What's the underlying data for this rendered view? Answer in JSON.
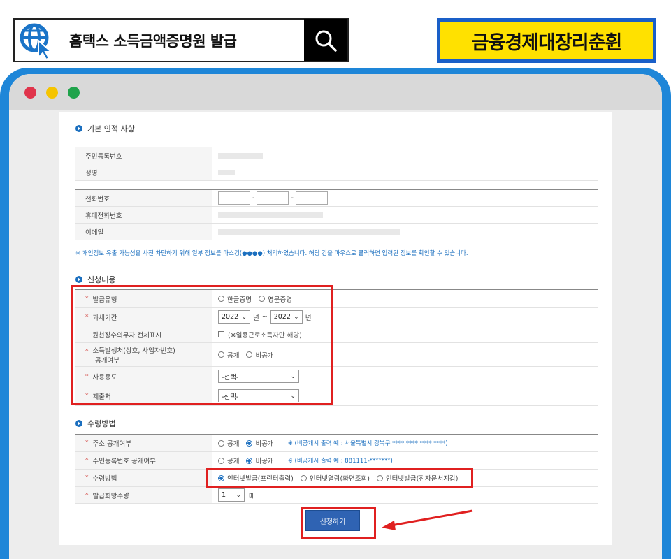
{
  "search": {
    "query": "홈택스 소득금액증명원 발급"
  },
  "brand": {
    "label": "금융경제대장리춘휜"
  },
  "window_dots": [
    "#e0344b",
    "#f5c400",
    "#1fa34b"
  ],
  "basic": {
    "title": "기본 인적 사항",
    "rows": [
      "주민등록번호",
      "성명"
    ],
    "contact_rows": [
      "전화번호",
      "휴대전화번호",
      "이메일"
    ],
    "notice": "※ 개인정보 유출 가능성을 사전 차단하기 위해 일부 정보를 마스킹(●●●●) 처리하였습니다. 해당 칸을 마우스로 클릭하면 입력된 정보를 확인할 수 있습니다."
  },
  "apply": {
    "title": "신청내용",
    "issue_type": {
      "label": "발급유형",
      "options": [
        "한글증명",
        "영문증명"
      ]
    },
    "tax_period": {
      "label": "과세기간",
      "from": "2022",
      "from_unit": "년",
      "sep": "~",
      "to": "2022",
      "to_unit": "년"
    },
    "withholding": {
      "label": "원천징수의무자 전체표시",
      "text": "(※일용근로소득자만 해당)"
    },
    "income_source": {
      "label_line1": "소득발생처(상호, 사업자번호)",
      "label_line2": "공개여부",
      "options": [
        "공개",
        "비공개"
      ]
    },
    "purpose": {
      "label": "사용용도",
      "value": "-선택-"
    },
    "submit_to": {
      "label": "제출처",
      "value": "-선택-"
    }
  },
  "receive": {
    "title": "수령방법",
    "address": {
      "label": "주소 공개여부",
      "options": [
        "공개",
        "비공개"
      ],
      "hint": "※ (비공개시 출력 예 : 서울특별시 강북구 **** **** **** ****)"
    },
    "rrn": {
      "label": "주민등록번호 공개여부",
      "options": [
        "공개",
        "비공개"
      ],
      "hint": "※ (비공개시 출력 예 : 881111-*******)"
    },
    "method": {
      "label": "수령방법",
      "options": [
        "인터넷발급(프린터출력)",
        "인터넷열람(화면조회)",
        "인터넷발급(전자문서지갑)"
      ]
    },
    "copies": {
      "label": "발급희망수량",
      "value": "1",
      "unit": "매"
    }
  },
  "submit_button": "신청하기",
  "colors": {
    "accent": "#1b6fbf",
    "highlight": "#e02020",
    "frame": "#1e86d8",
    "brand_bg": "#ffe100"
  }
}
